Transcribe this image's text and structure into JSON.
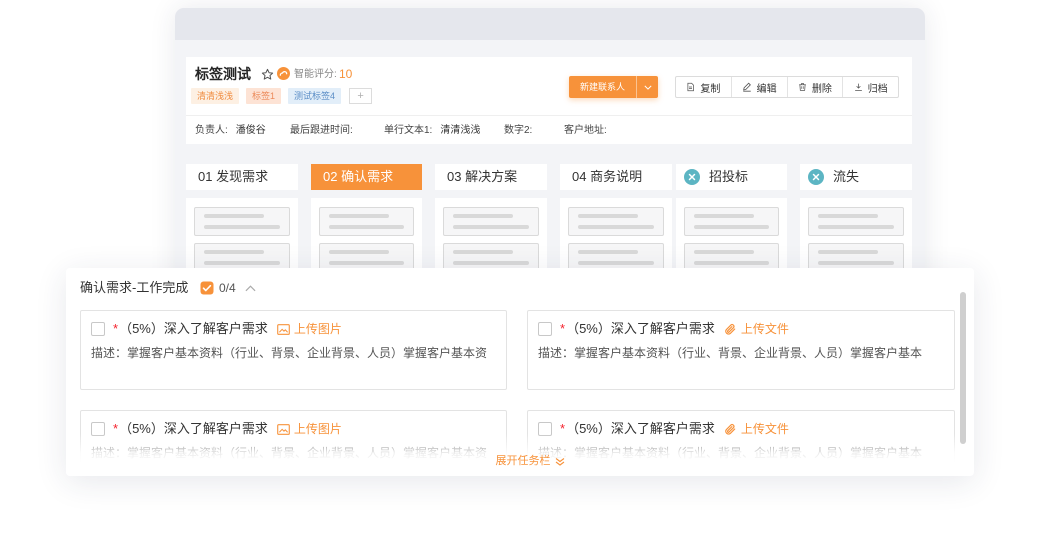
{
  "colors": {
    "accent": "#f7923a",
    "required": "#f5222d",
    "stage_closed": "#5cb5c3",
    "text": "#333333"
  },
  "record": {
    "title": "标签测试",
    "favorite_icon": "star-icon",
    "score_icon": "smart-score-icon",
    "score_label": "智能评分:",
    "score_value": "10",
    "tags": [
      {
        "label": "清清浅浅",
        "text_color": "#f08a3c",
        "bg_color": "#fdf0e3"
      },
      {
        "label": "标签1",
        "text_color": "#ec8a5a",
        "bg_color": "#fde3d5"
      },
      {
        "label": "测试标签4",
        "text_color": "#5a8dc6",
        "bg_color": "#e2eef9"
      }
    ],
    "add_tag": "+",
    "new_contact": "新建联系人",
    "actions": [
      {
        "label": "复制",
        "icon": "copy-icon"
      },
      {
        "label": "编辑",
        "icon": "edit-icon"
      },
      {
        "label": "删除",
        "icon": "delete-icon"
      },
      {
        "label": "归档",
        "icon": "archive-icon"
      }
    ],
    "fields": [
      {
        "label": "负责人:",
        "value": "潘俊谷"
      },
      {
        "label": "最后跟进时间:"
      },
      {
        "label": "单行文本1:",
        "value": "清清浅浅"
      },
      {
        "label": "数字2:"
      },
      {
        "label": "客户地址:"
      }
    ]
  },
  "stages": [
    {
      "label": "01 发现需求",
      "active": false
    },
    {
      "label": "02 确认需求",
      "active": true
    },
    {
      "label": "03 解决方案",
      "active": false
    },
    {
      "label": "04 商务说明",
      "active": false
    },
    {
      "label": "招投标",
      "active": false,
      "icon": "close-circle-icon"
    },
    {
      "label": "流失",
      "active": false,
      "icon": "close-circle-icon"
    }
  ],
  "task_panel": {
    "title": "确认需求-工作完成",
    "progress": "0/4",
    "expand_label": "展开任务栏",
    "tasks": [
      {
        "checked": false,
        "required": "*",
        "title": "（5%）深入了解客户需求",
        "upload_label": "上传图片",
        "upload_icon": "image-icon",
        "description": "描述：掌握客户基本资料（行业、背景、企业背景、人员）掌握客户基本资"
      },
      {
        "checked": false,
        "required": "*",
        "title": "（5%）深入了解客户需求",
        "upload_label": "上传文件",
        "upload_icon": "paperclip-icon",
        "description": "描述：掌握客户基本资料（行业、背景、企业背景、人员）掌握客户基本"
      },
      {
        "checked": false,
        "required": "*",
        "title": "（5%）深入了解客户需求",
        "upload_label": "上传图片",
        "upload_icon": "image-icon",
        "description": "描述：掌握客户基本资料（行业、背景、企业背景、人员）掌握客户基本资"
      },
      {
        "checked": false,
        "required": "*",
        "title": "（5%）深入了解客户需求",
        "upload_label": "上传文件",
        "upload_icon": "paperclip-icon",
        "description": "描述：掌握客户基本资料（行业、背景、企业背景、人员）掌握客户基本"
      }
    ]
  }
}
